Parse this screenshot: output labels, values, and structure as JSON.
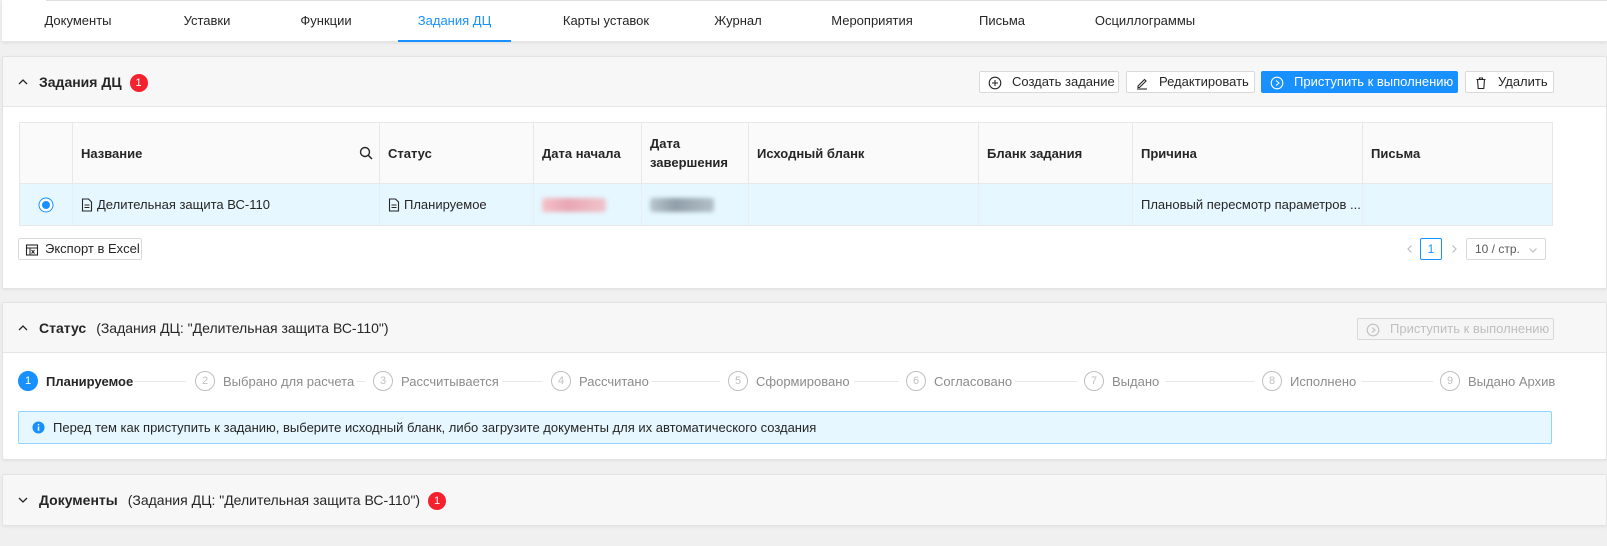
{
  "tabs": [
    "Документы",
    "Уставки",
    "Функции",
    "Задания ДЦ",
    "Карты уставок",
    "Журнал",
    "Мероприятия",
    "Письма",
    "Осциллограммы"
  ],
  "active_tab": "Задания ДЦ",
  "tasks_panel": {
    "title": "Задания ДЦ",
    "badge": "1",
    "buttons": {
      "create": "Создать задание",
      "edit": "Редактировать",
      "start": "Приступить к выполнению",
      "delete": "Удалить"
    },
    "table": {
      "headers": {
        "name": "Название",
        "status": "Статус",
        "start_date": "Дата начала",
        "end_date_line1": "Дата",
        "end_date_line2": "завершения",
        "source_form": "Исходный бланк",
        "task_form": "Бланк задания",
        "reason": "Причина",
        "letters": "Письма"
      },
      "rows": [
        {
          "name": "Делительная защита ВС-110",
          "status": "Планируемое",
          "start_date": "",
          "end_date": "",
          "source_form": "",
          "task_form": "",
          "reason": "Плановый пересмотр параметров ...",
          "letters": ""
        }
      ]
    },
    "export_label": "Экспорт в Excel",
    "pagination": {
      "current_page": "1",
      "page_size": "10 / стр."
    }
  },
  "status_panel": {
    "title": "Статус",
    "subtitle": "(Задания ДЦ: \"Делительная защита ВС-110\")",
    "start_button": "Приступить к выполнению",
    "steps": [
      {
        "num": "1",
        "label": "Планируемое"
      },
      {
        "num": "2",
        "label": "Выбрано для расчета"
      },
      {
        "num": "3",
        "label": "Рассчитывается"
      },
      {
        "num": "4",
        "label": "Рассчитано"
      },
      {
        "num": "5",
        "label": "Сформировано"
      },
      {
        "num": "6",
        "label": "Согласовано"
      },
      {
        "num": "7",
        "label": "Выдано"
      },
      {
        "num": "8",
        "label": "Исполнено"
      },
      {
        "num": "9",
        "label": "Выдано Архив"
      }
    ],
    "current_step": 1,
    "info_message": "Перед тем как приступить к заданию, выберите исходный бланк, либо загрузите документы для их автоматического создания"
  },
  "documents_panel": {
    "title": "Документы",
    "subtitle": "(Задания ДЦ: \"Делительная защита ВС-110\")",
    "badge": "1"
  },
  "colors": {
    "accent": "#1890ff",
    "badge": "#f5222d",
    "selected_row": "#e6f7ff"
  }
}
